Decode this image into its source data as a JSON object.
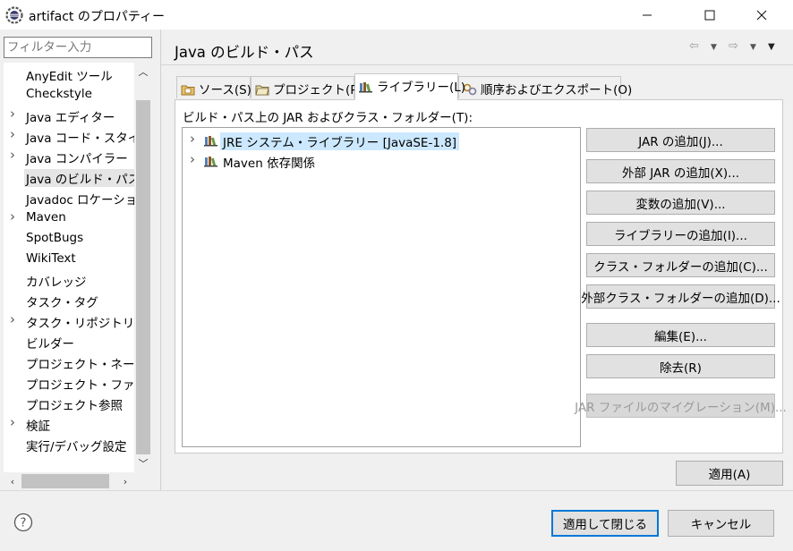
{
  "window": {
    "title": "artifact のプロパティー",
    "minimize": "—",
    "maximize": "☐",
    "close": "✕"
  },
  "sidebar": {
    "filter_placeholder": "フィルター入力",
    "items": [
      {
        "label": "AnyEdit ツール",
        "expandable": false
      },
      {
        "label": "Checkstyle",
        "expandable": false
      },
      {
        "label": "Java エディター",
        "expandable": true
      },
      {
        "label": "Java コード・スタイル",
        "expandable": true
      },
      {
        "label": "Java コンパイラー",
        "expandable": true
      },
      {
        "label": "Java のビルド・パス",
        "expandable": false,
        "selected": true
      },
      {
        "label": "Javadoc ロケーション",
        "expandable": false
      },
      {
        "label": "Maven",
        "expandable": true
      },
      {
        "label": "SpotBugs",
        "expandable": false
      },
      {
        "label": "WikiText",
        "expandable": false
      },
      {
        "label": "カバレッジ",
        "expandable": false
      },
      {
        "label": "タスク・タグ",
        "expandable": false
      },
      {
        "label": "タスク・リポジトリー",
        "expandable": true
      },
      {
        "label": "ビルダー",
        "expandable": false
      },
      {
        "label": "プロジェクト・ネーチャー",
        "expandable": false
      },
      {
        "label": "プロジェクト・ファセット",
        "expandable": false
      },
      {
        "label": "プロジェクト参照",
        "expandable": false
      },
      {
        "label": "検証",
        "expandable": true
      },
      {
        "label": "実行/デバッグ設定",
        "expandable": false
      }
    ]
  },
  "header": {
    "title": "Java のビルド・パス"
  },
  "tabs": [
    {
      "label": "ソース(S)",
      "icon": "source-folder-icon"
    },
    {
      "label": "プロジェクト(P)",
      "icon": "project-folder-icon"
    },
    {
      "label": "ライブラリー(L)",
      "icon": "library-icon",
      "active": true
    },
    {
      "label": "順序およびエクスポート(O)",
      "icon": "order-export-icon"
    }
  ],
  "libraries": {
    "label": "ビルド・パス上の JAR およびクラス・フォルダー(T):",
    "items": [
      {
        "label": "JRE システム・ライブラリー [JavaSE-1.8]",
        "selected": true
      },
      {
        "label": "Maven 依存関係",
        "selected": false
      }
    ]
  },
  "buttons": [
    {
      "label": "JAR の追加(J)...",
      "enabled": true
    },
    {
      "label": "外部 JAR の追加(X)...",
      "enabled": true
    },
    {
      "label": "変数の追加(V)...",
      "enabled": true
    },
    {
      "label": "ライブラリーの追加(I)...",
      "enabled": true
    },
    {
      "label": "クラス・フォルダーの追加(C)...",
      "enabled": true
    },
    {
      "label": "外部クラス・フォルダーの追加(D)...",
      "enabled": true
    },
    {
      "label": "編集(E)...",
      "enabled": true
    },
    {
      "label": "除去(R)",
      "enabled": true
    },
    {
      "label": "JAR ファイルのマイグレーション(M)...",
      "enabled": false
    }
  ],
  "footer": {
    "apply": "適用(A)",
    "apply_close": "適用して閉じる",
    "cancel": "キャンセル"
  },
  "colors": {
    "selection": "#cce8ff",
    "default_button_border": "#0078d7"
  }
}
